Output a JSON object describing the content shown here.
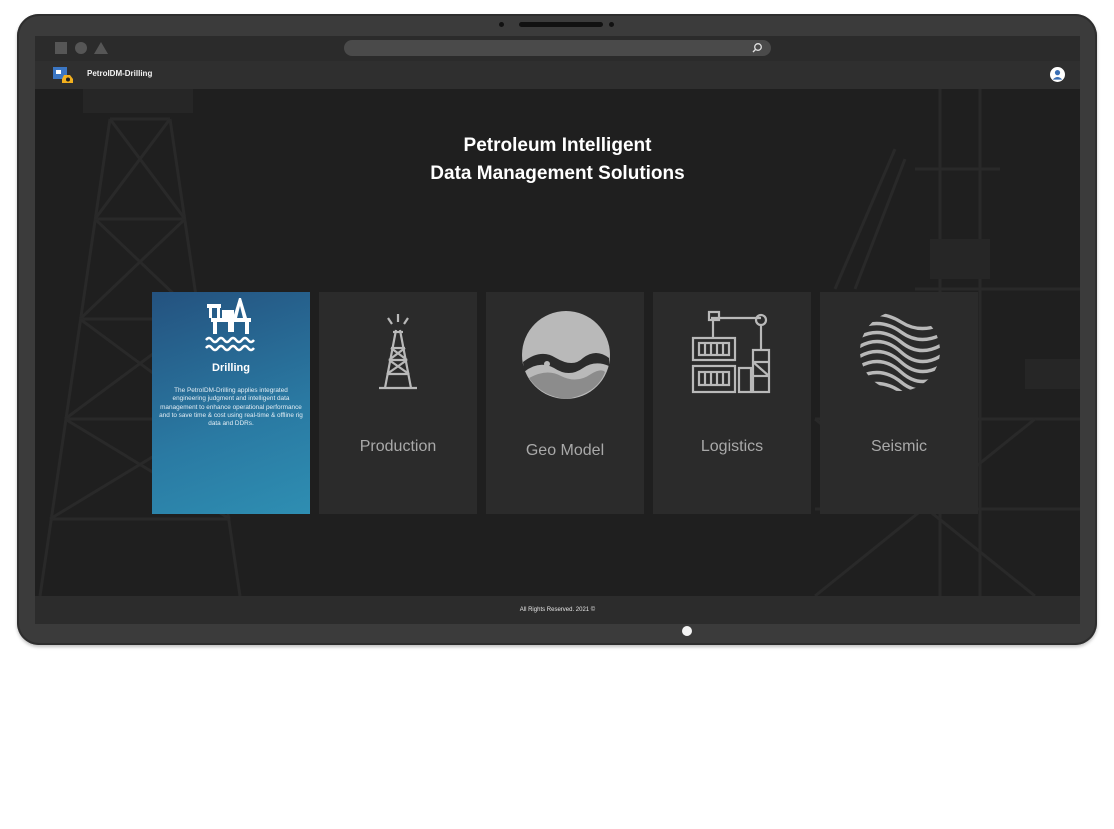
{
  "app": {
    "title": "PetroIDM-Drilling"
  },
  "hero": {
    "line1": "Petroleum Intelligent",
    "line2": "Data Management Solutions"
  },
  "cards": [
    {
      "title": "Drilling",
      "description": "The PetroIDM-Drilling applies integrated engineering judgment and intelligent data management to enhance operational performance and to save time & cost using real-time & offline rig data and DDRs.",
      "icon": "offshore-rig-icon",
      "active": true
    },
    {
      "title": "Production",
      "icon": "oil-derrick-icon"
    },
    {
      "title": "Geo Model",
      "icon": "geo-model-icon"
    },
    {
      "title": "Logistics",
      "icon": "crane-containers-icon"
    },
    {
      "title": "Seismic",
      "icon": "seismic-waves-icon"
    }
  ],
  "footer": {
    "text": "All Rights Reserved. 2021 ©"
  },
  "colors": {
    "active_card_top": "#24527f",
    "active_card_bottom": "#2e8eb2",
    "card_bg": "#2b2b2b",
    "page_bg": "#1f1f1f"
  }
}
